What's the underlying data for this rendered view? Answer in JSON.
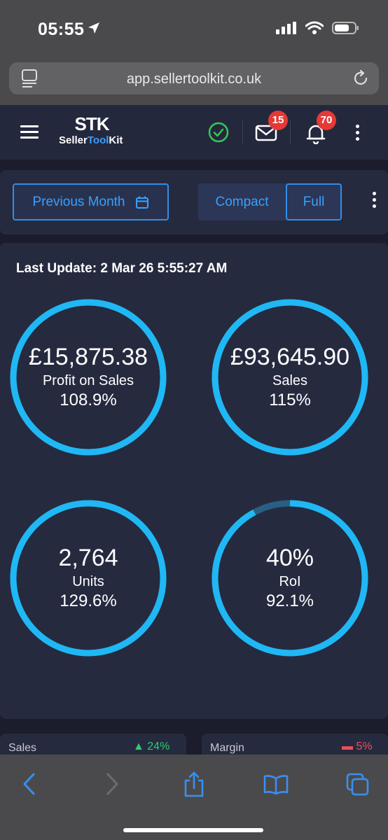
{
  "status": {
    "time": "05:55"
  },
  "browser": {
    "url": "app.sellertoolkit.co.uk"
  },
  "header": {
    "logo_mark": "STK",
    "logo_text_a": "Seller",
    "logo_text_b": "Tool",
    "logo_text_c": "Kit",
    "mail_badge": "15",
    "bell_badge": "70"
  },
  "toolbar": {
    "period_label": "Previous Month",
    "compact_label": "Compact",
    "full_label": "Full"
  },
  "stats": {
    "last_update": "Last Update: 2 Mar 26 5:55:27 AM",
    "tiles": [
      {
        "value": "£15,875.38",
        "label": "Profit on Sales",
        "pct": "108.9%",
        "ring_fill": 1.0
      },
      {
        "value": "£93,645.90",
        "label": "Sales",
        "pct": "115%",
        "ring_fill": 1.0
      },
      {
        "value": "2,764",
        "label": "Units",
        "pct": "129.6%",
        "ring_fill": 1.0
      },
      {
        "value": "40%",
        "label": "RoI",
        "pct": "92.1%",
        "ring_fill": 0.921
      }
    ]
  },
  "peek": {
    "left_label": "Sales",
    "left_change": "▲ 24%",
    "right_label": "Margin",
    "right_change": "▬ 5%"
  },
  "colors": {
    "ring": "#1fb8f5",
    "ring_track": "#2a5e84",
    "accent": "#3aa0ff",
    "badge": "#e53935"
  }
}
